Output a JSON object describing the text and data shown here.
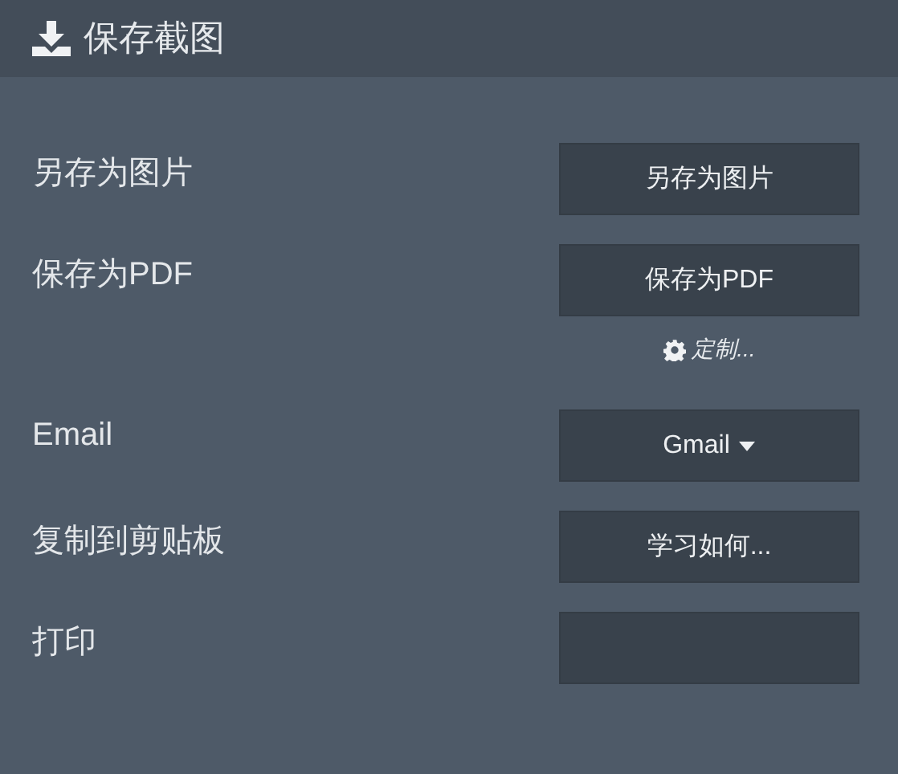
{
  "header": {
    "title": "保存截图"
  },
  "rows": [
    {
      "label": "另存为图片",
      "button": {
        "text": "另存为图片",
        "dropdown": false
      }
    },
    {
      "label": "保存为PDF",
      "button": {
        "text": "保存为PDF",
        "dropdown": false
      },
      "link": "定制..."
    },
    {
      "label": "Email",
      "button": {
        "text": "Gmail",
        "dropdown": true
      }
    },
    {
      "label": "复制到剪贴板",
      "button": {
        "text": "学习如何...",
        "dropdown": false
      }
    },
    {
      "label": "打印",
      "button": {
        "dropdown": false
      }
    }
  ]
}
